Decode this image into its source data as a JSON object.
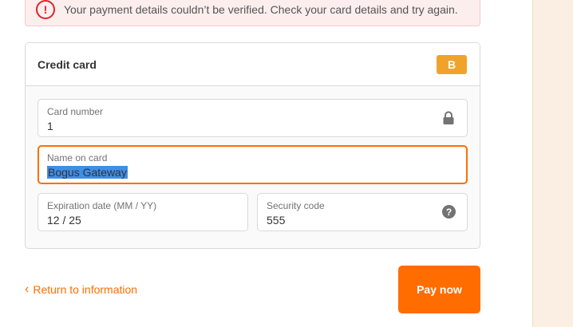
{
  "error": {
    "icon": "exclamation-circle-icon",
    "icon_glyph": "!",
    "message": "Your payment details couldn’t be verified. Check your card details and try again."
  },
  "payment": {
    "title": "Credit card",
    "badge_icon": "bogus-gateway-icon",
    "badge_letter": "B",
    "fields": {
      "card_number": {
        "label": "Card number",
        "value": "1",
        "icon": "lock-icon"
      },
      "name_on_card": {
        "label": "Name on card",
        "value": "Bogus Gateway",
        "focused": true,
        "selected": true
      },
      "expiration": {
        "label": "Expiration date (MM / YY)",
        "value": "12 / 25"
      },
      "security_code": {
        "label": "Security code",
        "value": "555",
        "icon": "question-mark-icon",
        "icon_glyph": "?"
      }
    }
  },
  "actions": {
    "return_label": "Return to information",
    "return_icon": "chevron-left-icon",
    "return_glyph": "‹",
    "pay_label": "Pay now"
  },
  "colors": {
    "accent": "#ff6d00",
    "error": "#e0232a",
    "error_bg": "#fdeeee",
    "badge": "#f0a32a",
    "selection": "#3f8ee8",
    "side_panel": "#fbeee3"
  }
}
